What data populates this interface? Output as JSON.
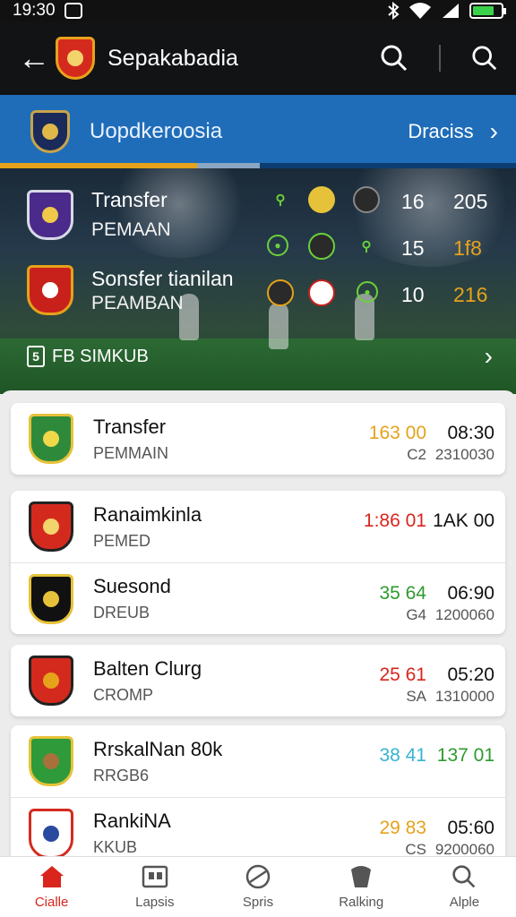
{
  "status_bar": {
    "time": "19:30"
  },
  "app_bar": {
    "title": "Sepakabadia"
  },
  "banner": {
    "label": "Uopdkeroosia",
    "action": "Draciss"
  },
  "hero": {
    "rows": [
      {
        "name": "Transfer",
        "sub": "PEMAAN",
        "stat_a": "16",
        "stat_b": "205"
      },
      {
        "name": "",
        "sub": "",
        "stat_a": "15",
        "stat_b": "1f8"
      },
      {
        "name": "Sonsfer tianilan",
        "sub": "PEAMBAN",
        "stat_a": "10",
        "stat_b": "216"
      }
    ],
    "footer_label": "FB SIMKUB",
    "footer_icon_glyph": "5"
  },
  "list": {
    "cards": [
      {
        "rows": [
          {
            "title": "Transfer",
            "sub": "PEMMAIN",
            "v1": "163 00",
            "v2": "08:30",
            "v3": "C2",
            "v4": "2310030",
            "v1_color": "#e6a21b"
          }
        ]
      },
      {
        "rows": [
          {
            "title": "Ranaimkinla",
            "sub": "PEMED",
            "v1": "1:86 01",
            "v2": "1AK 00",
            "v3": "",
            "v4": "",
            "v1_color": "#d9251c"
          },
          {
            "title": "Suesond",
            "sub": "DREUB",
            "v1": "35 64",
            "v2": "06:90",
            "v3": "G4",
            "v4": "1200060",
            "v1_color": "#2e9a2e"
          }
        ]
      },
      {
        "rows": [
          {
            "title": "Balten Clurg",
            "sub": "CROMP",
            "v1": "25 61",
            "v2": "05:20",
            "v3": "SA",
            "v4": "1310000",
            "v1_color": "#d9251c"
          }
        ]
      },
      {
        "rows": [
          {
            "title": "RrskalNan 80k",
            "sub": "RRGB6",
            "v1": "38 41",
            "v2": "137 01",
            "v3": "",
            "v4": "",
            "v1_color": "#38b3d1",
            "v2_color": "#2e9a2e"
          },
          {
            "title": "RankiNA",
            "sub": "KKUB",
            "v1": "29 83",
            "v2": "05:60",
            "v3": "CS",
            "v4": "9200060",
            "v1_color": "#e6a21b"
          }
        ]
      }
    ]
  },
  "nav": {
    "items": [
      {
        "label": "Cialle"
      },
      {
        "label": "Lapsis"
      },
      {
        "label": "Spris"
      },
      {
        "label": "Ralking"
      },
      {
        "label": "Alple"
      }
    ]
  },
  "colors": {
    "accent": "#1f6db9",
    "active": "#d9251c",
    "gold": "#e6a21b"
  }
}
